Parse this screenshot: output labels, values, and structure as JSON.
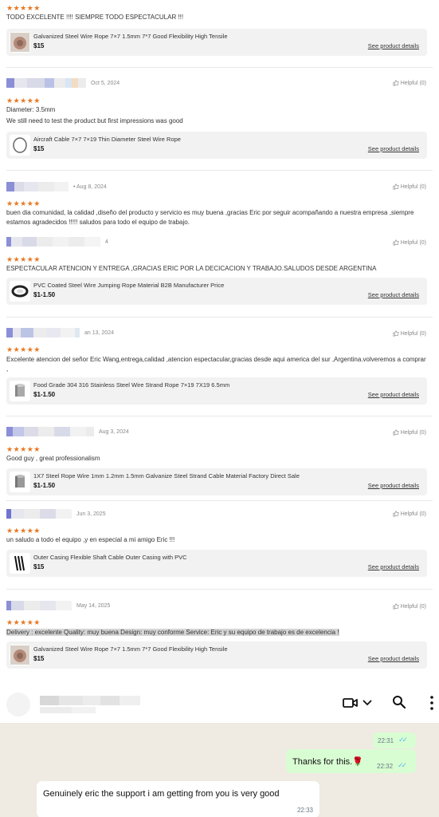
{
  "colors": {
    "star": "#e87722",
    "bubble_out": "#d9fdd3",
    "chat_bg": "#efeae2",
    "ticks": "#53bdeb"
  },
  "reviews": [
    {
      "stars": "★★★★★",
      "text": "TODO EXCELENTE !!!!  SIEMPRE TODO ESPECTACULAR !!!",
      "product": {
        "name": "Galvanized Steel Wire Rope 7×7 1.5mm 7*7 Good Flexibility High Tensile",
        "price": "$15",
        "details": "See product details",
        "icon": "wire-coil-icon"
      }
    },
    {
      "date": "Oct 5, 2024",
      "helpful": "Helpful (0)",
      "stars": "★★★★★",
      "attribute": "Diameter:  3.5mm",
      "text": "We still need to test the product but first impressions was good",
      "product": {
        "name": "Aircraft Cable 7×7 7×19 Thin Diameter Steel Wire Rope",
        "price": "$15",
        "details": "See product details",
        "icon": "cable-loop-icon"
      }
    },
    {
      "date": "• Aug 8, 2024",
      "helpful": "Helpful (0)",
      "stars": "★★★★★",
      "text": "buen dia comunidad, la calidad ,diseño del producto y servicio es muy buena ,gracias Eric por seguir acompañando a nuestra empresa ,siempre estamos agradecidos !!!!! saludos para todo el equipo de trabajo."
    },
    {
      "date": "4",
      "helpful": "Helpful (0)",
      "stars": "★★★★★",
      "text": "ESPECTACULAR ATENCION Y ENTREGA ,GRACIAS ERIC POR LA DECICACION Y TRABAJO.SALUDOS DESDE ARGENTINA",
      "product": {
        "name": "PVC Coated Steel Wire Jumping Rope Material B2B Manufacturer Price",
        "price": "$1-1.50",
        "details": "See product details",
        "icon": "coil-icon"
      }
    },
    {
      "date": "an 13, 2024",
      "helpful": "Helpful (0)",
      "stars": "★★★★★",
      "text": "Excelente atencion del señor Eric Wang,entrega,calidad ,atencion espectacular,gracias desde aqui america del sur ,Argentina.volveremos a comprar ,",
      "product": {
        "name": "Food Grade 304 316 Stainless Steel Wire Strand Rope 7×19 7X19 6.5mm",
        "price": "$1-1.50",
        "details": "See product details",
        "icon": "steel-roll-icon"
      }
    },
    {
      "date": "Aug 3, 2024",
      "helpful": "Helpful (0)",
      "stars": "★★★★★",
      "text": "Good guy , great professionalism",
      "product": {
        "name": "1X7 Steel Rope Wire 1mm 1.2mm 1.5mm Galvanize Steel Strand Cable Material Factory Direct Sale",
        "price": "$1-1.50",
        "details": "See product details",
        "icon": "steel-roll-icon"
      }
    },
    {
      "date": "Jun 3, 2025",
      "helpful": "Helpful (0)",
      "stars": "★★★★★",
      "text": "un saludo a todo el equipo ,y en especial a mi amigo Eric !!!",
      "product": {
        "name": "Outer Casing Flexible Shaft Cable Outer Casing with PVC",
        "price": "$15",
        "details": "See product details",
        "icon": "black-cable-icon"
      }
    },
    {
      "date": "May 14, 2025",
      "helpful": "Helpful (0)",
      "stars": "★★★★★",
      "text": "Delivery : excelente Quality: muy buena Design: muy conforme Service: Eric y su equipo de trabajo es de excelencia !",
      "product": {
        "name": "Galvanized Steel Wire Rope 7×7 1.5mm 7*7 Good Flexibility High Tensile",
        "price": "$15",
        "details": "See product details",
        "icon": "wire-coil-icon"
      }
    }
  ],
  "chat": {
    "header_icons": [
      "video-call-icon",
      "chevron-down-icon",
      "search-icon",
      "more-menu-icon"
    ],
    "messages": [
      {
        "direction": "out",
        "text": "",
        "time": "22:31"
      },
      {
        "direction": "out",
        "text": "Thanks for this.🌹",
        "time": "22:32"
      },
      {
        "direction": "in",
        "text": "Genuinely eric the support i am getting from you is very good",
        "time": "22:33"
      }
    ]
  }
}
